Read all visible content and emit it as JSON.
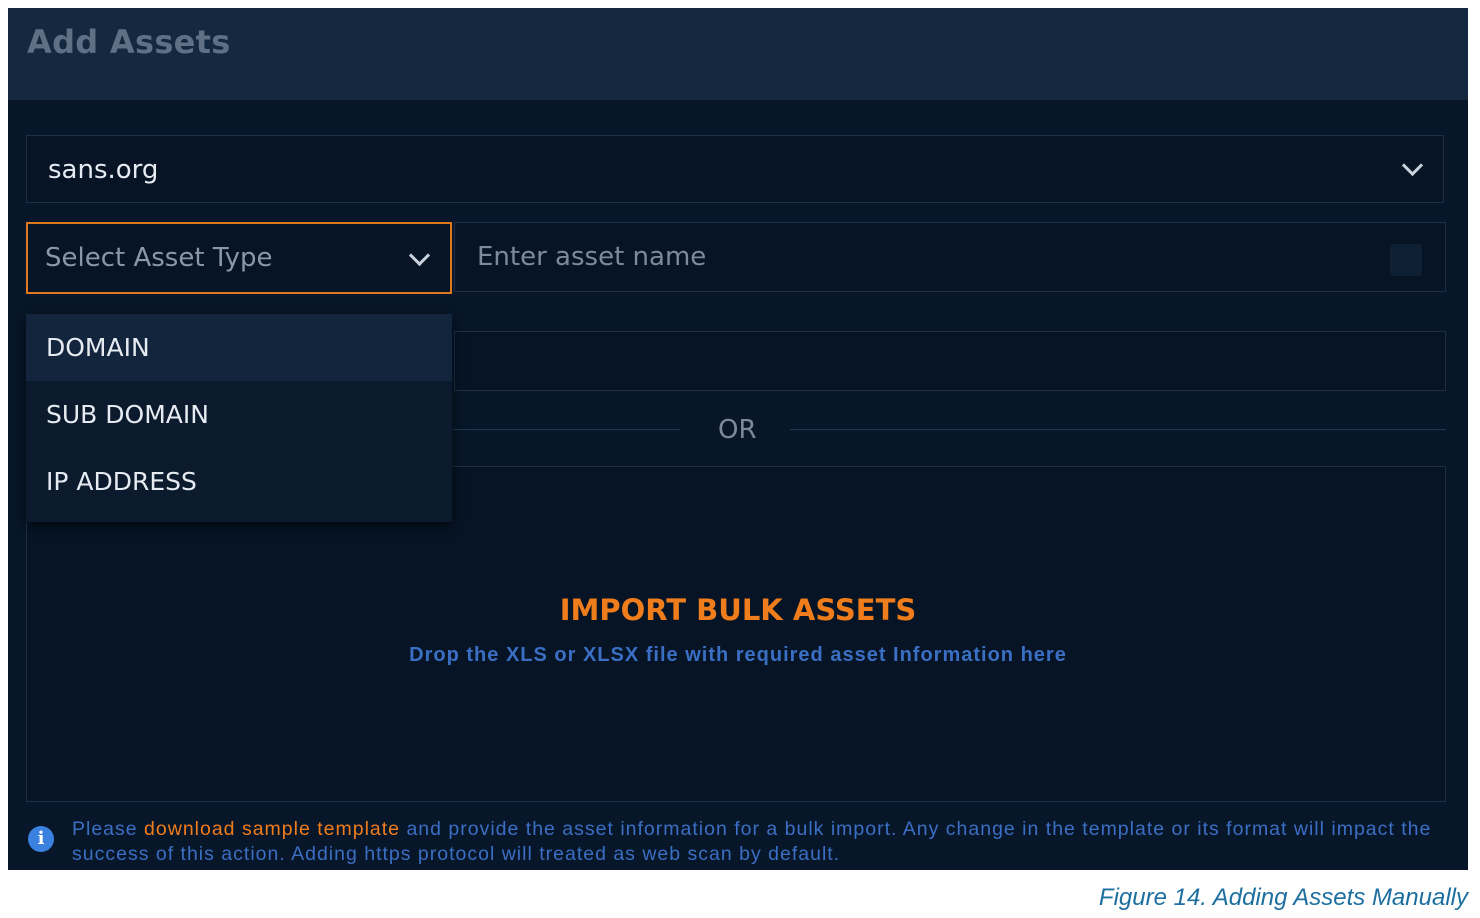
{
  "header": {
    "title": "Add Assets"
  },
  "org_select": {
    "value": "sans.org",
    "icon": "chevron-down-icon"
  },
  "asset_type": {
    "placeholder": "Select Asset Type",
    "icon": "chevron-down-icon",
    "options": [
      "DOMAIN",
      "SUB DOMAIN",
      "IP ADDRESS"
    ],
    "highlighted": "DOMAIN"
  },
  "asset_name": {
    "placeholder": "Enter asset name",
    "value": ""
  },
  "divider": {
    "label": "OR"
  },
  "import": {
    "title": "IMPORT BULK ASSETS",
    "subtitle": "Drop the XLS or XLSX file with required asset Information here"
  },
  "note": {
    "icon": "info-icon",
    "prefix": "Please ",
    "link": "download sample template",
    "suffix": " and provide the asset information for a bulk import. Any change in the template or its format will impact the success of this action. Adding https protocol will treated as web scan by default."
  },
  "caption": "Figure 14. Adding Assets Manually",
  "colors": {
    "accent": "#ef7d1c",
    "link_blue": "#3a6fc4",
    "panel_bg": "#071628",
    "header_bg": "#142840"
  }
}
